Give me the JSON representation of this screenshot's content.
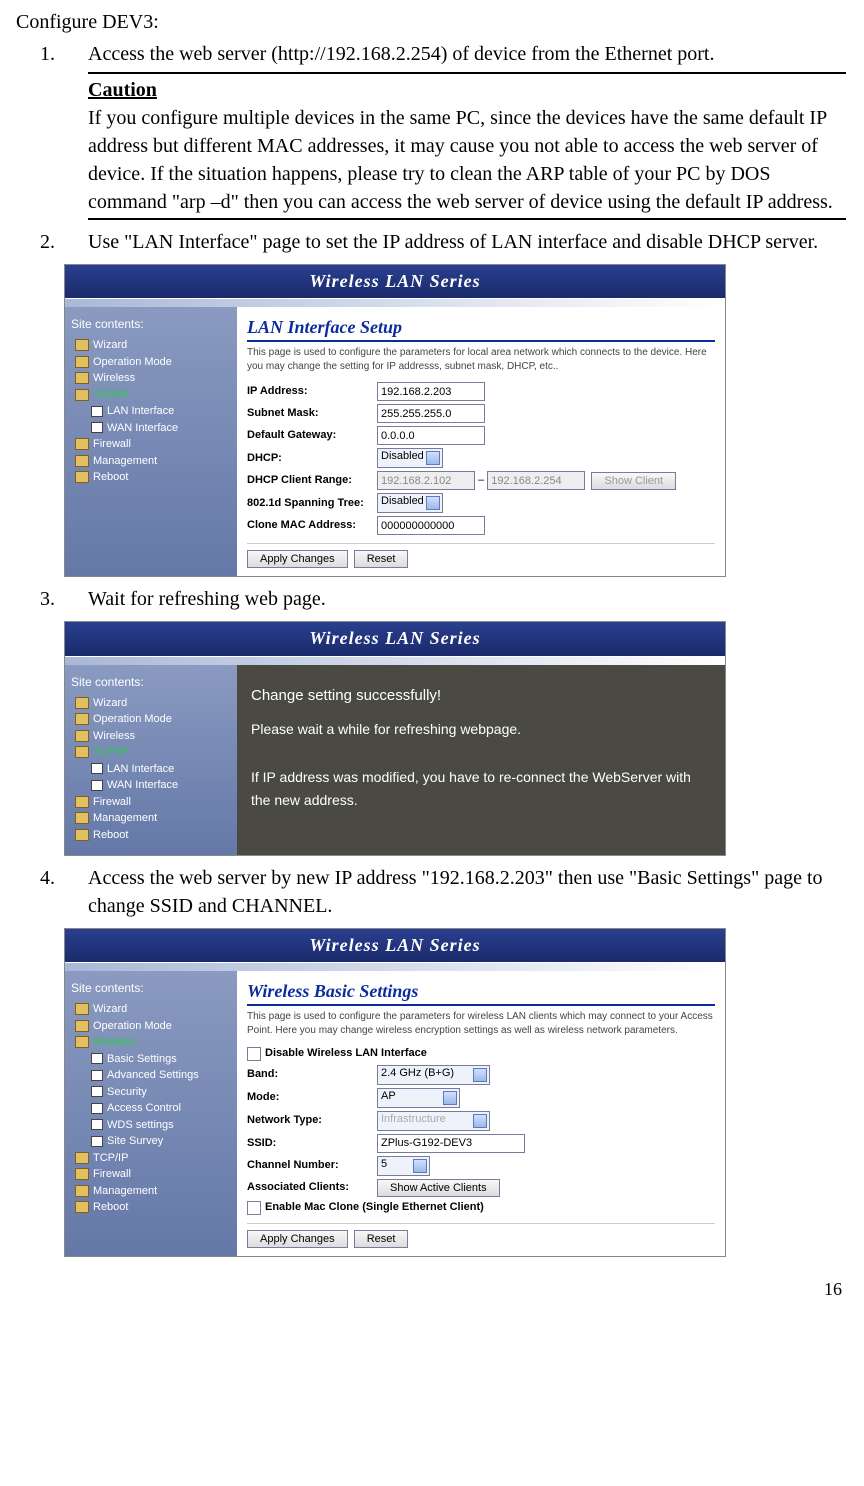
{
  "heading": "Configure DEV3:",
  "steps": {
    "s1": {
      "num": "1.",
      "text": "Access the web server (http://192.168.2.254) of device from the Ethernet port.",
      "caution_title": "Caution",
      "caution_body": "If you configure multiple devices in the same PC, since the devices have the same default IP address but different MAC addresses, it may cause you not able to access the web server of device. If the situation happens, please try to clean the ARP table of your PC by DOS command \"arp –d\" then you can access the web server of device using the default IP address."
    },
    "s2": {
      "num": "2.",
      "text": "Use \"LAN Interface\" page to set the IP address of LAN interface and disable DHCP server."
    },
    "s3": {
      "num": "3.",
      "text": "Wait for refreshing web page."
    },
    "s4": {
      "num": "4.",
      "text": "Access the web server by new IP address \"192.168.2.203\" then use \"Basic Settings\" page to change SSID and CHANNEL."
    }
  },
  "banner": "Wireless LAN Series",
  "nav_title": "Site contents:",
  "nav": {
    "wizard": "Wizard",
    "opmode": "Operation Mode",
    "wireless": "Wireless",
    "tcpip": "TCP/IP",
    "lan": "LAN Interface",
    "wan": "WAN Interface",
    "firewall": "Firewall",
    "mgmt": "Management",
    "reboot": "Reboot",
    "basic": "Basic Settings",
    "adv": "Advanced Settings",
    "sec": "Security",
    "ac": "Access Control",
    "wds": "WDS settings",
    "survey": "Site Survey"
  },
  "shot1": {
    "title": "LAN Interface Setup",
    "desc": "This page is used to configure the parameters for local area network which connects to the device. Here you may change the setting for IP addresss, subnet mask, DHCP, etc..",
    "rows": {
      "ip_l": "IP Address:",
      "ip_v": "192.168.2.203",
      "sm_l": "Subnet Mask:",
      "sm_v": "255.255.255.0",
      "gw_l": "Default Gateway:",
      "gw_v": "0.0.0.0",
      "dhcp_l": "DHCP:",
      "dhcp_v": "Disabled",
      "range_l": "DHCP Client Range:",
      "range_a": "192.168.2.102",
      "range_dash": "–",
      "range_b": "192.168.2.254",
      "range_btn": "Show Client",
      "span_l": "802.1d Spanning Tree:",
      "span_v": "Disabled",
      "mac_l": "Clone MAC Address:",
      "mac_v": "000000000000"
    },
    "apply": "Apply Changes",
    "reset": "Reset"
  },
  "shot2": {
    "m1": "Change setting successfully!",
    "m2": "Please wait a while for refreshing webpage.",
    "m3": "If IP address was modified, you have to re-connect the WebServer with the new address."
  },
  "shot3": {
    "title": "Wireless Basic Settings",
    "desc": "This page is used to configure the parameters for wireless LAN clients which may connect to your Access Point. Here you may change wireless encryption settings as well as wireless network parameters.",
    "disable_l": "Disable Wireless LAN Interface",
    "rows": {
      "band_l": "Band:",
      "band_v": "2.4 GHz (B+G)",
      "mode_l": "Mode:",
      "mode_v": "AP",
      "nt_l": "Network Type:",
      "nt_v": "Infrastructure",
      "ssid_l": "SSID:",
      "ssid_v": "ZPlus-G192-DEV3",
      "ch_l": "Channel Number:",
      "ch_v": "5",
      "assoc_l": "Associated Clients:",
      "assoc_btn": "Show Active Clients",
      "macclone_l": "Enable Mac Clone (Single Ethernet Client)"
    },
    "apply": "Apply Changes",
    "reset": "Reset"
  },
  "pagenum": "16"
}
